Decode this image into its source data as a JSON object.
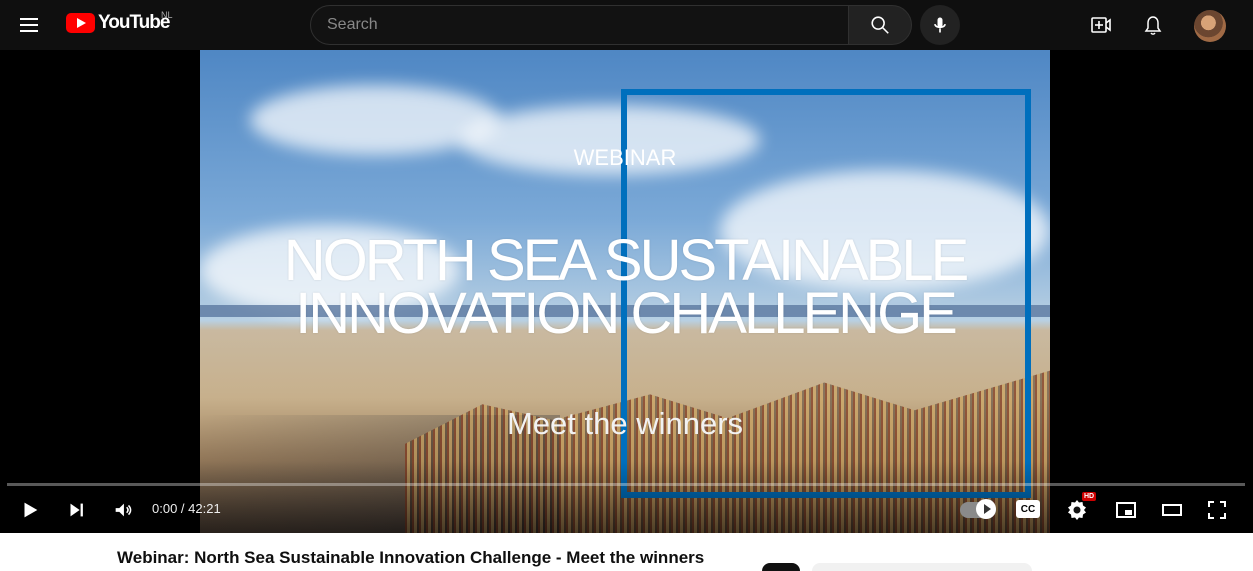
{
  "header": {
    "logo_text": "YouTube",
    "country": "NL",
    "search_placeholder": "Search"
  },
  "video": {
    "slide_label": "WEBINAR",
    "slide_title_line1": "NORTH SEA SUSTAINABLE",
    "slide_title_line2": "INNOVATION CHALLENGE",
    "slide_subtitle": "Meet the winners",
    "time_display": "0:00 / 42:21",
    "progress": 0,
    "hd_badge": "HD",
    "cc_label": "CC",
    "title": "Webinar: North Sea Sustainable Innovation Challenge - Meet the winners"
  },
  "colors": {
    "youtube_red": "#ff0000",
    "slide_blue": "#006fbd"
  },
  "icons": {
    "menu": "menu-icon",
    "search": "search-icon",
    "mic": "microphone-icon",
    "create": "create-video-icon",
    "notifications": "bell-icon",
    "play": "play-icon",
    "next": "next-icon",
    "volume": "volume-icon",
    "settings": "gear-icon",
    "miniplayer": "miniplayer-icon",
    "theater": "theater-icon",
    "fullscreen": "fullscreen-icon"
  }
}
